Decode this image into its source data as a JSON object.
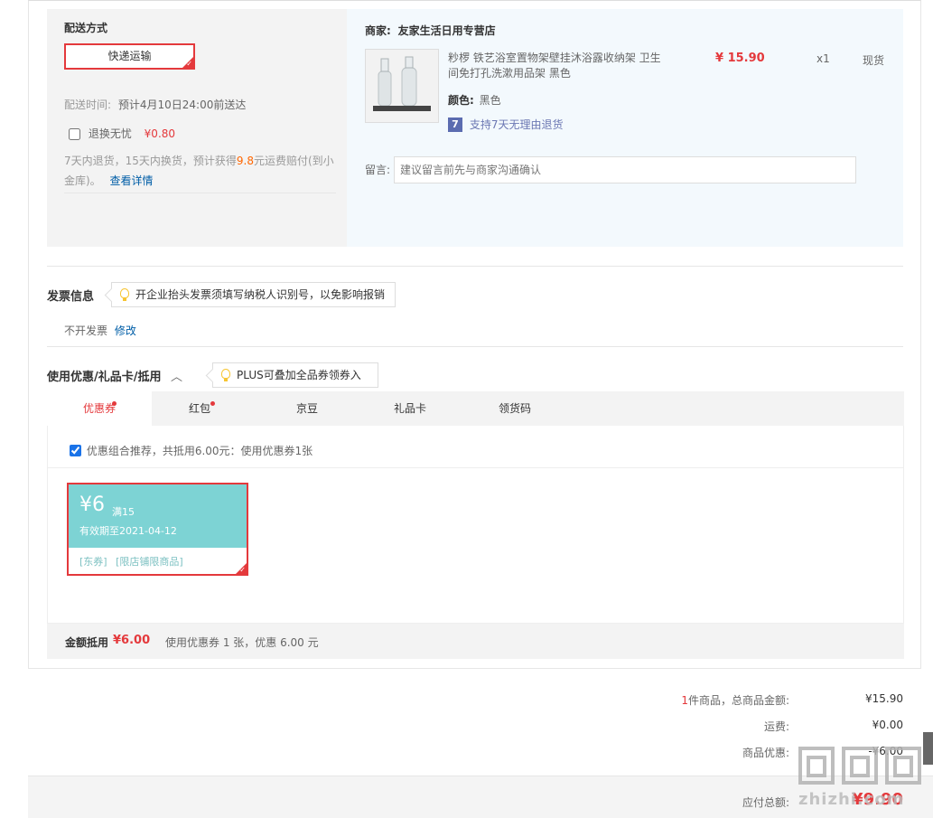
{
  "shipping": {
    "title": "配送方式",
    "method_label": "快递运输",
    "time_label": "配送时间:",
    "time_value": "预计4月10日24:00前送达",
    "insurance_label": "退换无忧",
    "insurance_price": "¥0.80",
    "insurance_desc_1": "7天内退货，15天内换货，预计获得",
    "insurance_desc_amount": "9.8",
    "insurance_desc_2": "元运费赔付(到小",
    "insurance_desc_3": "金库)。",
    "details_link": "查看详情"
  },
  "shop": {
    "merchant_label": "商家:",
    "merchant_name": "友家生活日用专营店",
    "product_title_line1": "粆椤 铁艺浴室置物架壁挂沐浴露收纳架 卫生",
    "product_title_line2": "间免打孔洗漱用品架 黑色",
    "price": "¥ 15.90",
    "quantity": "x1",
    "stock": "现货",
    "color_label": "颜色:",
    "color_value": "黑色",
    "return_badge": "7",
    "return_text": "支持7天无理由退货",
    "message_label": "留言:",
    "message_placeholder": "建议留言前先与商家沟通确认"
  },
  "invoice": {
    "title": "发票信息",
    "tip": "开企业抬头发票须填写纳税人识别号，以免影响报销",
    "value": "不开发票",
    "edit_link": "修改"
  },
  "discount": {
    "title": "使用优惠/礼品卡/抵用",
    "tip": "PLUS可叠加全品券领券入口",
    "tabs": [
      "优惠券",
      "红包",
      "京豆",
      "礼品卡",
      "领货码"
    ],
    "recommend_text": "优惠组合推荐，共抵用6.00元：使用优惠券1张",
    "coupon_amount": "¥6",
    "coupon_condition": "满15",
    "coupon_expiry": "有效期至2021-04-12",
    "coupon_tag1": "[东券]",
    "coupon_tag2": "[限店铺限商品]",
    "summary_label": "金额抵用",
    "summary_amount": "¥6.00",
    "summary_text": "使用优惠券 1 张，优惠 6.00 元"
  },
  "totals": {
    "count": "1",
    "count_suffix": "件商品，总商品金额:",
    "goods_amount": "¥15.90",
    "freight_label": "运费:",
    "freight_amount": "¥0.00",
    "discount_label": "商品优惠:",
    "discount_amount": "-¥6.00",
    "payable_label": "应付总额:",
    "payable_amount": "¥9.90"
  },
  "watermark": "zhizhi.com",
  "colors": {
    "accent": "#e4393c",
    "coupon": "#7dd3d4",
    "link": "#005ea7"
  }
}
